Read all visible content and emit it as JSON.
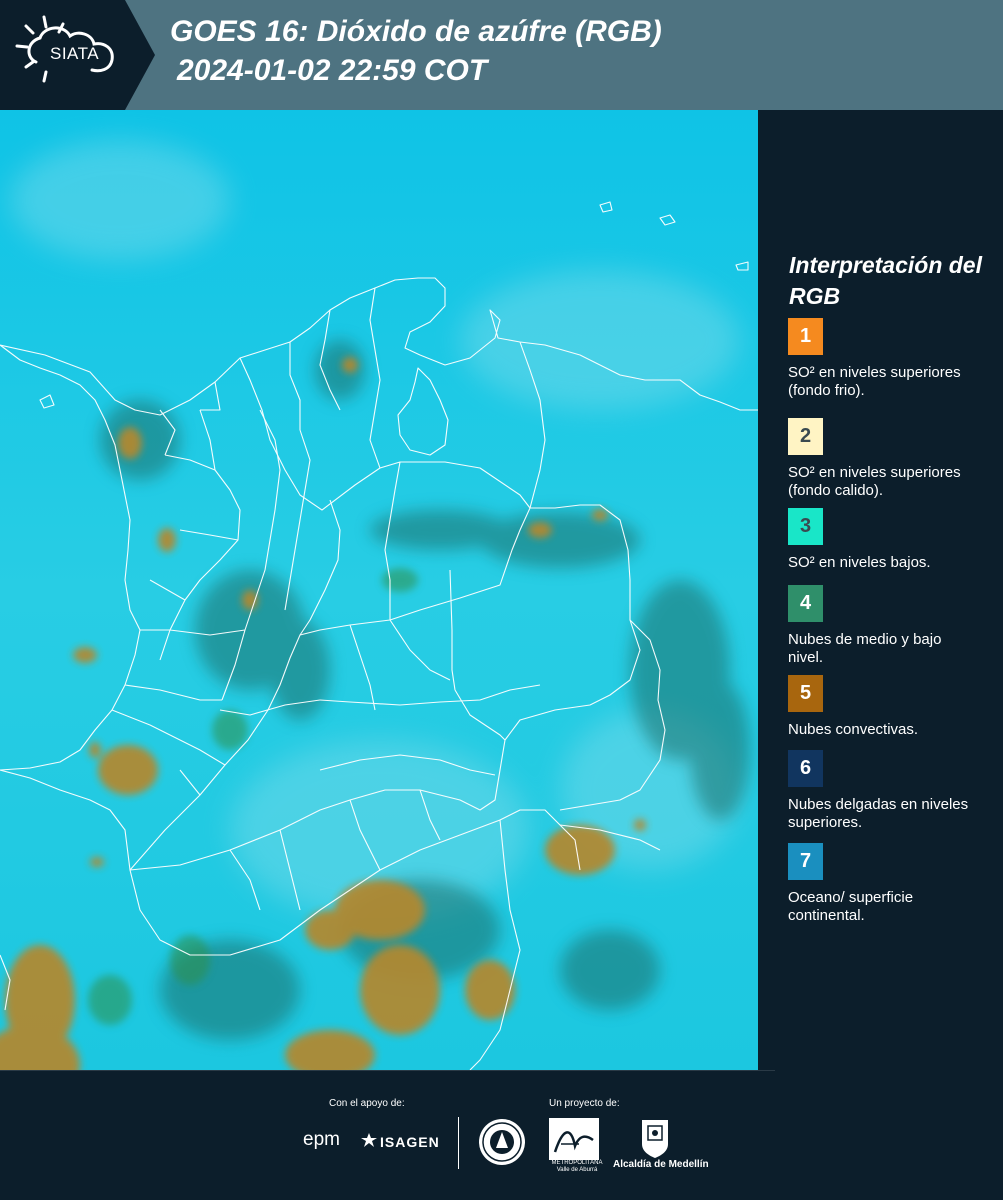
{
  "header": {
    "logo_text": "SIATA",
    "title_line1": "GOES 16: Dióxido de azúfre (RGB)",
    "title_line2": "2024-01-02 22:59 COT"
  },
  "legend": {
    "title": "Interpretación del RGB",
    "items": [
      {
        "number": "1",
        "color": "#f58a1f",
        "label": "SO² en niveles superiores (fondo frio)."
      },
      {
        "number": "2",
        "color": "#fff4c4",
        "label": "SO² en niveles superiores (fondo calido)."
      },
      {
        "number": "3",
        "color": "#19e6c8",
        "label": "SO² en niveles bajos."
      },
      {
        "number": "4",
        "color": "#2f8f6a",
        "label": "Nubes de medio y bajo nivel."
      },
      {
        "number": "5",
        "color": "#a8660e",
        "label": "Nubes convectivas."
      },
      {
        "number": "6",
        "color": "#11355f",
        "label": "Nubes delgadas en niveles superiores."
      },
      {
        "number": "7",
        "color": "#1a8fbf",
        "label": "Oceano/ superficie continental."
      }
    ]
  },
  "footer": {
    "support_caption": "Con el apoyo de:",
    "project_caption": "Un proyecto de:",
    "sponsor_1": "epm",
    "sponsor_2": "ISAGEN",
    "partner_area_sub": "METROPOLITANA Valle de Aburrá",
    "partner_alcaldia": "Alcaldía de Medellín"
  },
  "colors": {
    "header_bg": "#4e7381",
    "logo_bg": "#0c1e2b",
    "panel_bg": "#0c1e2b",
    "map_cyan": "#15c6e4",
    "convective_cloud": "#b4882d",
    "low_cloud": "#2f8f6a",
    "borders": "#ffffff"
  }
}
